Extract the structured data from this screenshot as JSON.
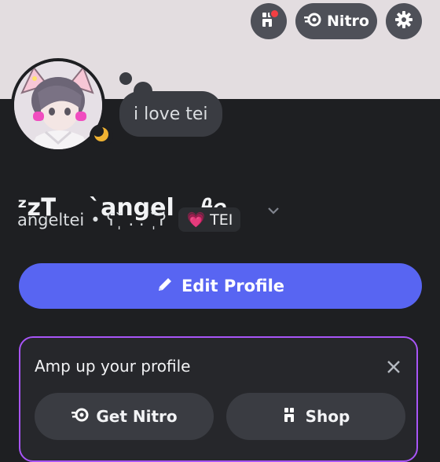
{
  "header": {
    "nitro_label": "Nitro",
    "shop_icon": "shop-icon",
    "settings_icon": "gear-icon"
  },
  "profile": {
    "status_bubble": "i love tei",
    "display_name": "ᶻz𝐓    `angel   𝜗𝜚",
    "username": "angeltei",
    "separator": "•",
    "pronouns": "ʕ˘̩ . . ˘̩ʔ",
    "tag_label": "TEI",
    "tag_icon": "💗",
    "status_icon": "moon-icon"
  },
  "actions": {
    "edit_label": "Edit Profile"
  },
  "promo": {
    "title": "Amp up your profile",
    "get_nitro_label": "Get Nitro",
    "shop_label": "Shop"
  },
  "colors": {
    "accent": "#5865f2",
    "promo_border": "#a855f7",
    "status_idle": "#f0b232"
  }
}
